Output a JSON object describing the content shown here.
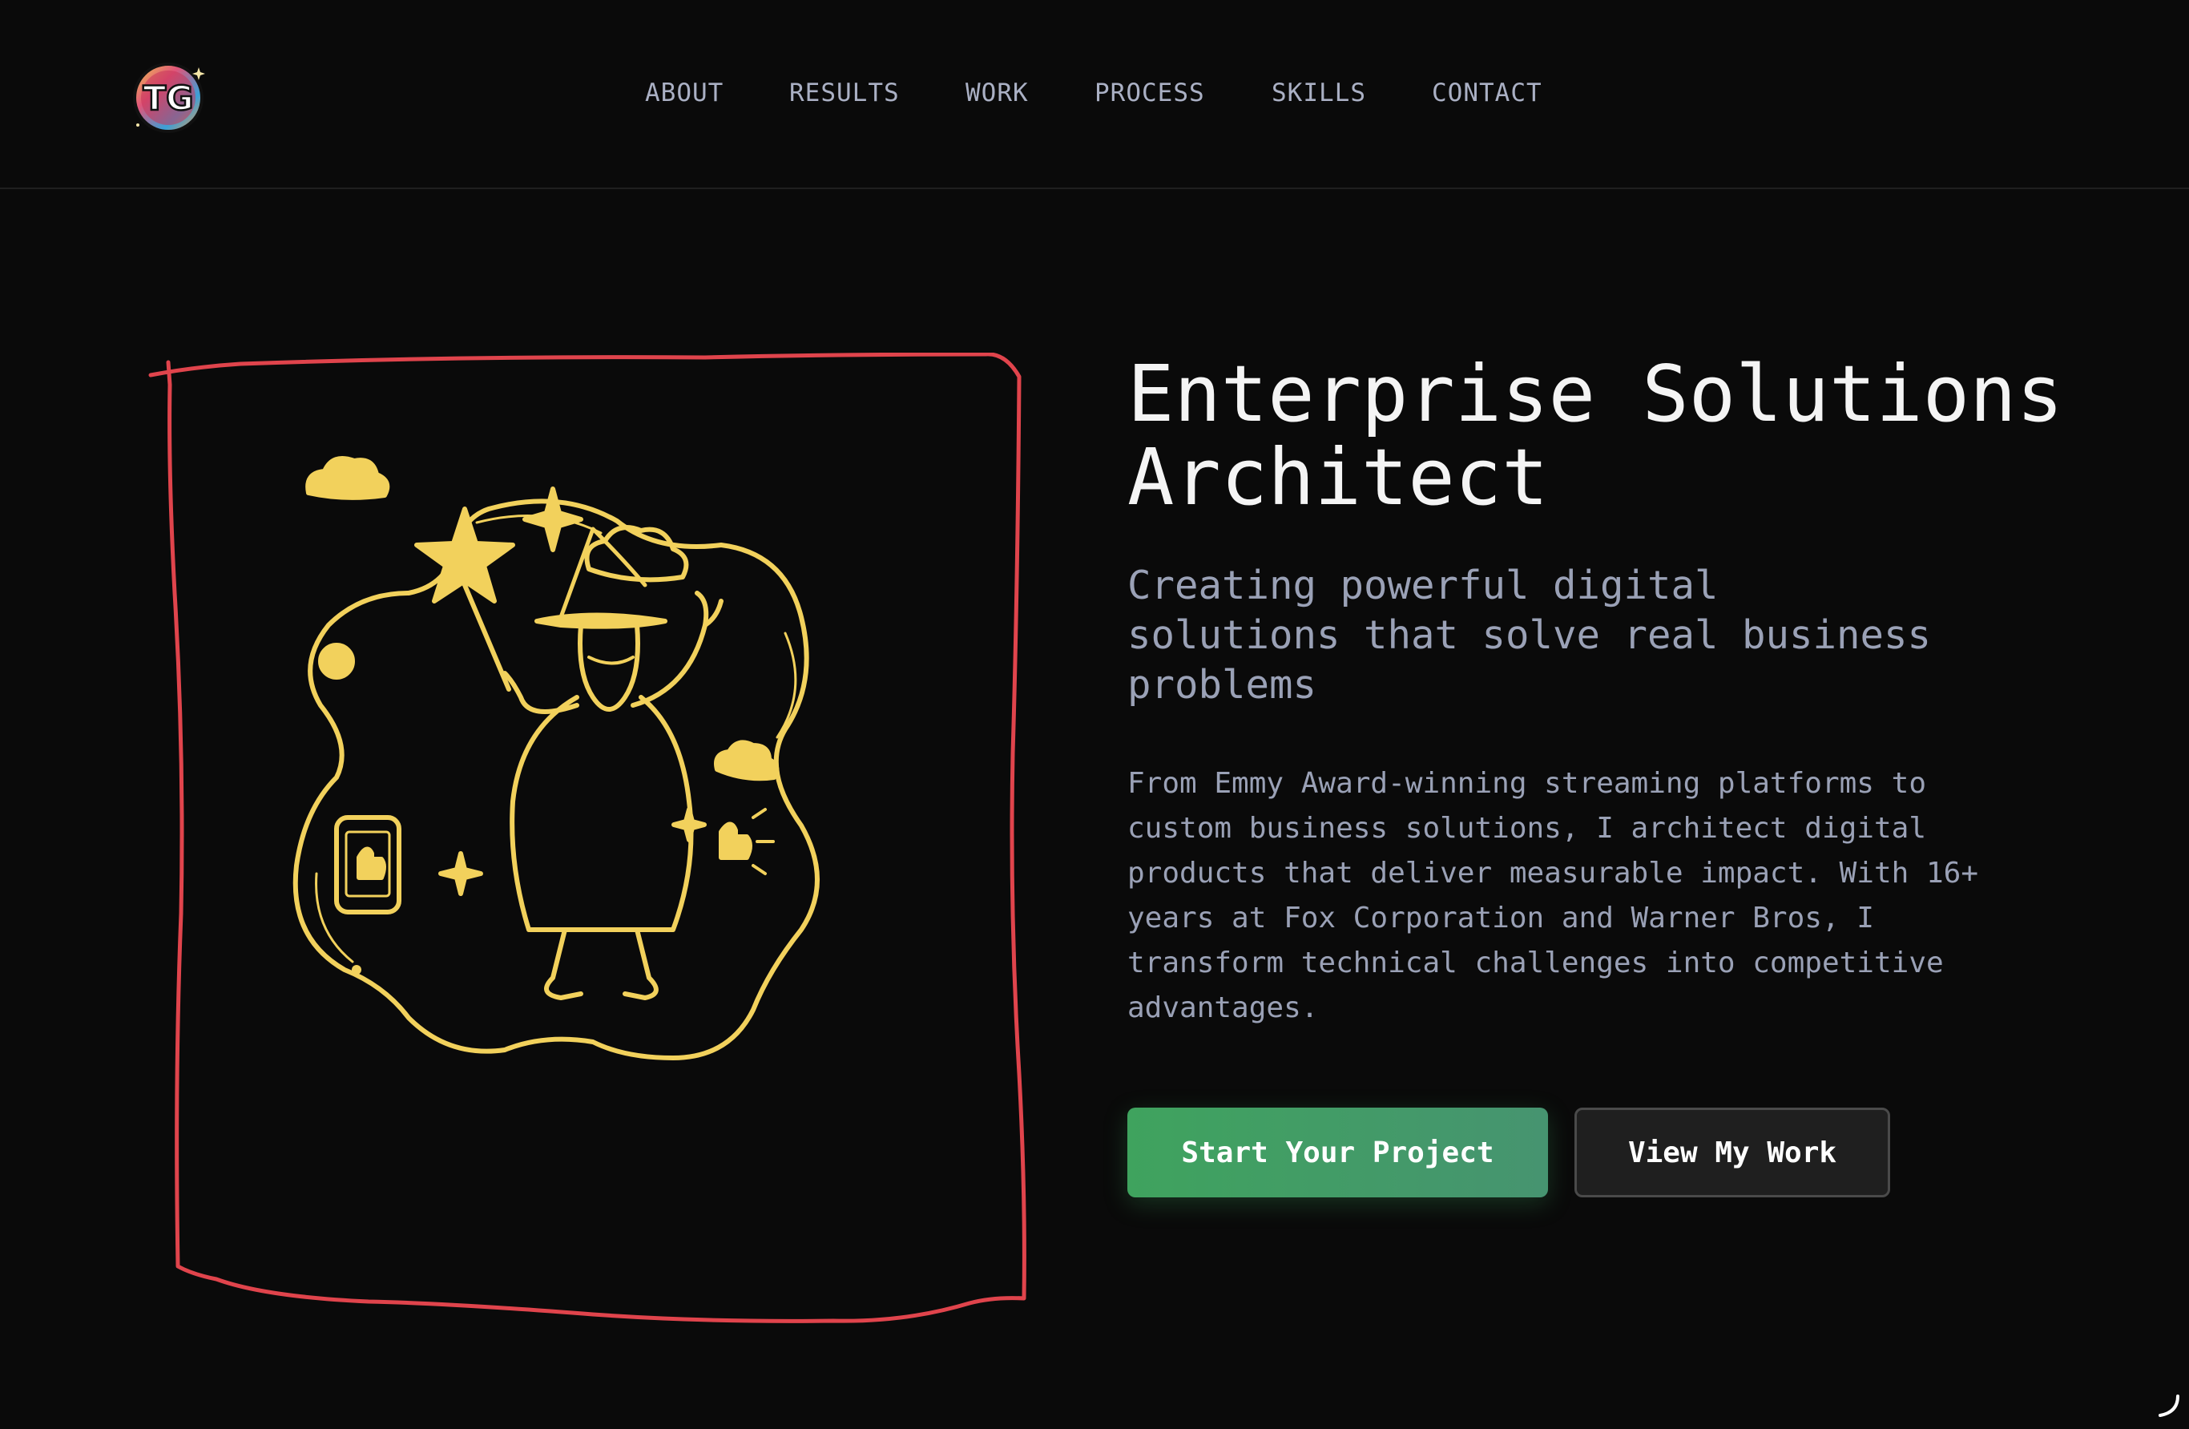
{
  "header": {
    "logo_text": "TG",
    "nav": [
      {
        "label": "ABOUT"
      },
      {
        "label": "RESULTS"
      },
      {
        "label": "WORK"
      },
      {
        "label": "PROCESS"
      },
      {
        "label": "SKILLS"
      },
      {
        "label": "CONTACT"
      }
    ]
  },
  "hero": {
    "title_lines": [
      "Enterprise Solutions",
      "Architect"
    ],
    "subtitle_lines": [
      "Creating powerful digital",
      "solutions that solve real business",
      "problems"
    ],
    "body_lines": [
      "From Emmy Award-winning streaming platforms to",
      "custom business solutions, I architect digital",
      "products that deliver measurable impact. With 16+",
      "years at Fox Corporation and Warner Bros, I",
      "transform technical challenges into competitive",
      "advantages."
    ],
    "primary_button": "Start Your Project",
    "secondary_button": "View My Work"
  },
  "illustration": {
    "subject": "wizard-illustration",
    "line_color": "#f2d15c",
    "frame_color": "#e0444c"
  },
  "colors": {
    "background": "#0a0a0a",
    "accent_green": "#3fa35e",
    "muted_text": "#9aa1b6"
  }
}
